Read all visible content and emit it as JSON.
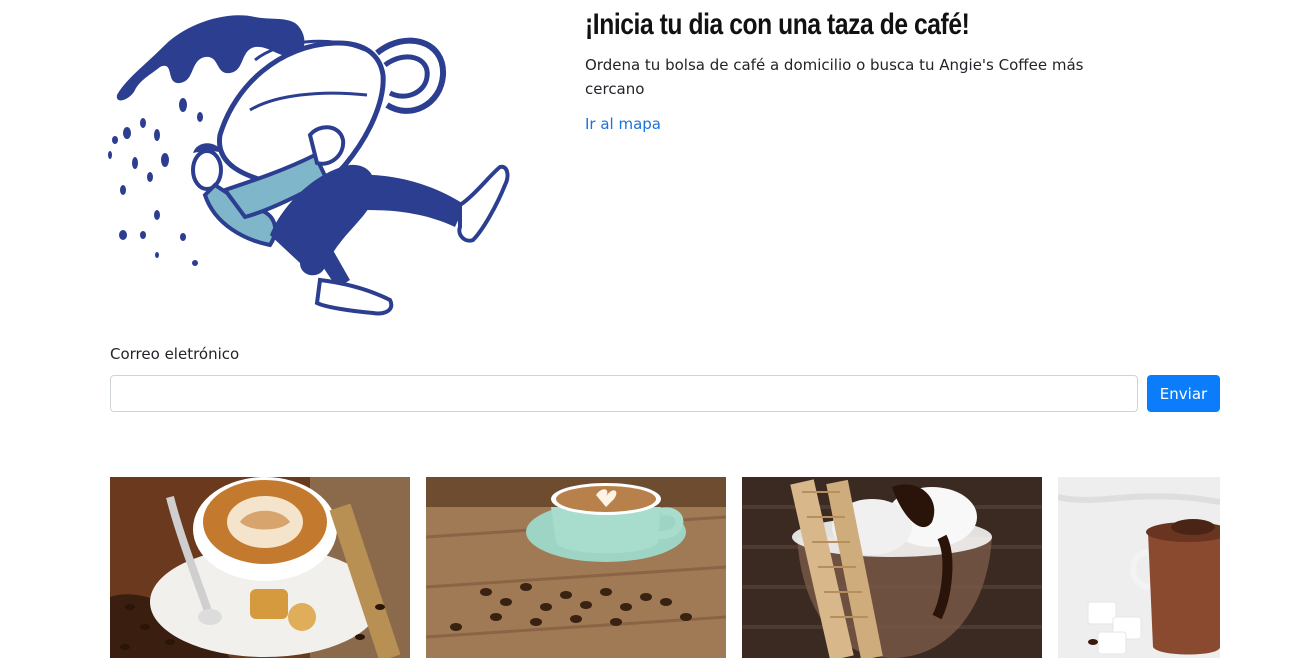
{
  "hero": {
    "title": "¡Inicia tu dia con una taza de café!",
    "description": "Ordena tu bolsa de café a domicilio o busca tu Angie's Coffee más cercano",
    "map_link": "Ir al mapa",
    "illustration_icon": "coffee-cup-person-illustration"
  },
  "subscribe": {
    "email_label": "Correo eletrónico",
    "email_value": "",
    "email_placeholder": "",
    "send_label": "Enviar"
  },
  "gallery": {
    "items": [
      {
        "name": "latte-art-photo"
      },
      {
        "name": "cappuccino-heart-photo"
      },
      {
        "name": "ice-cream-sundae-photo"
      },
      {
        "name": "hot-chocolate-photo"
      }
    ]
  },
  "colors": {
    "illustration_blue": "#2c3e8f",
    "illustration_light": "#7fb6c9",
    "link": "#1a73d9",
    "button": "#0b7dfa"
  }
}
